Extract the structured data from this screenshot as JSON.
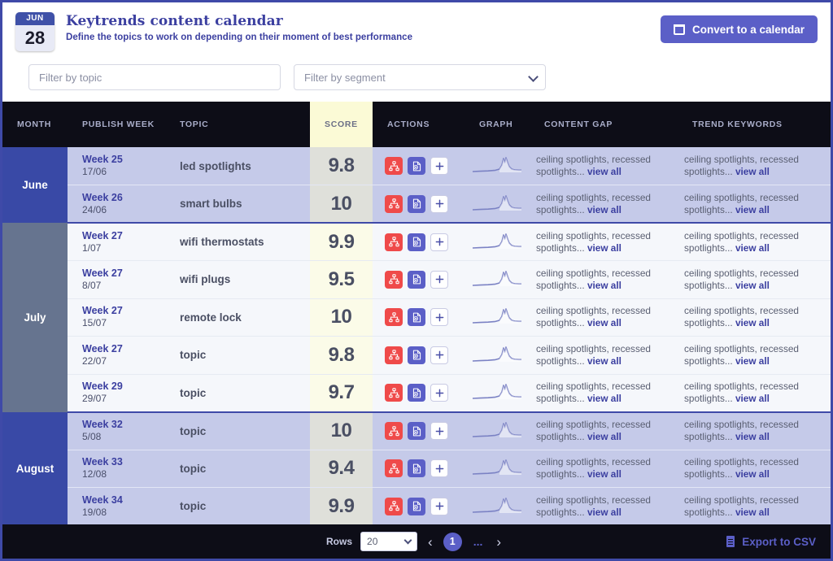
{
  "header": {
    "badge_month": "JUN",
    "badge_day": "28",
    "title": "Keytrends content calendar",
    "subtitle": "Define the topics to work on depending on their moment of best performance",
    "convert_button": "Convert to a calendar",
    "convert_icon": "calendar-icon"
  },
  "filters": {
    "topic_placeholder": "Filter by topic",
    "topic_value": "",
    "segment_placeholder": "Filter by segment",
    "segment_value": "Filter by segment",
    "segment_options": [
      "Filter by segment"
    ],
    "chevron_icon": "chevron-down-icon"
  },
  "table": {
    "columns": [
      "MONTH",
      "PUBLISH WEEK",
      "TOPIC",
      "SCORE",
      "ACTIONS",
      "GRAPH",
      "CONTENT GAP",
      "TREND KEYWORDS"
    ],
    "action_icons": [
      "sitemap-icon",
      "add-document-icon",
      "plus-icon"
    ],
    "plus_label": "+",
    "view_all_label": "view all",
    "gap_text": "ceiling spotlights, recessed spotlights...",
    "trend_text": "ceiling spotlights, recessed spotlights...",
    "months": [
      {
        "name": "June",
        "style": "june",
        "rowspan": 2
      },
      {
        "name": "July",
        "style": "july",
        "rowspan": 5
      },
      {
        "name": "August",
        "style": "august",
        "rowspan": 3
      }
    ],
    "rows": [
      {
        "month": "June",
        "week": "Week 25",
        "date": "17/06",
        "topic": "led spotlights",
        "score": "9.8"
      },
      {
        "month": "June",
        "week": "Week 26",
        "date": "24/06",
        "topic": "smart bulbs",
        "score": "10"
      },
      {
        "month": "July",
        "week": "Week 27",
        "date": "1/07",
        "topic": "wifi thermostats",
        "score": "9.9"
      },
      {
        "month": "July",
        "week": "Week 27",
        "date": "8/07",
        "topic": "wifi plugs",
        "score": "9.5"
      },
      {
        "month": "July",
        "week": "Week 27",
        "date": "15/07",
        "topic": "remote lock",
        "score": "10"
      },
      {
        "month": "July",
        "week": "Week 27",
        "date": "22/07",
        "topic": "topic",
        "score": "9.8"
      },
      {
        "month": "July",
        "week": "Week 29",
        "date": "29/07",
        "topic": "topic",
        "score": "9.7"
      },
      {
        "month": "August",
        "week": "Week 32",
        "date": "5/08",
        "topic": "topic",
        "score": "10"
      },
      {
        "month": "August",
        "week": "Week 33",
        "date": "12/08",
        "topic": "topic",
        "score": "9.4"
      },
      {
        "month": "August",
        "week": "Week 34",
        "date": "19/08",
        "topic": "topic",
        "score": "9.9"
      }
    ]
  },
  "footer": {
    "rows_label": "Rows",
    "rows_value": "20",
    "rows_options": [
      "20"
    ],
    "prev_label": "‹",
    "next_label": "›",
    "current_page": "1",
    "ellipsis": "...",
    "export_label": "Export to CSV",
    "export_icon": "file-icon"
  },
  "colors": {
    "accent": "#5b5fc7",
    "brand": "#3b3fa0",
    "month_june": "#3949a6",
    "month_july": "#66748f",
    "row_shaded": "#c5cae9",
    "row_light": "#f5f7fb",
    "score_header": "#fbfad6",
    "action_red": "#ef4a4a",
    "dark": "#0d0d17"
  }
}
